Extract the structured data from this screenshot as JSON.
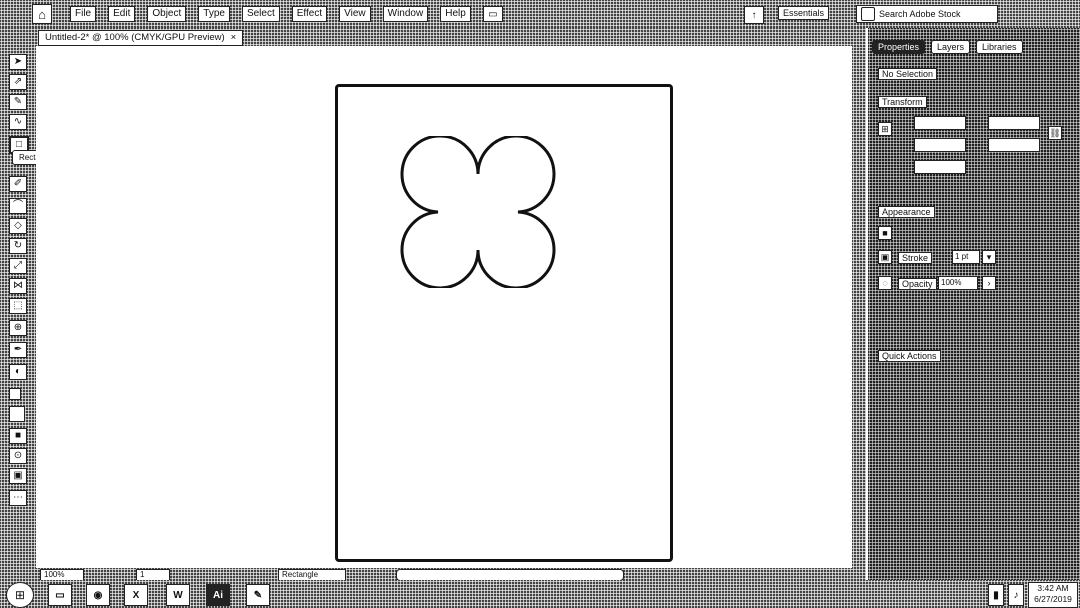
{
  "menubar": {
    "items": [
      "File",
      "Edit",
      "Object",
      "Type",
      "Select",
      "Effect",
      "View",
      "Window",
      "Help"
    ],
    "workspace_label": "Essentials",
    "search_placeholder": "Search Adobe Stock"
  },
  "document": {
    "tab_title": "Untitled-2* @ 100% (CMYK/GPU Preview)",
    "close_glyph": "×"
  },
  "tooltip": {
    "text": "Rectangle Tool (M)"
  },
  "statusbar": {
    "zoom": "100%",
    "artboard_num": "1",
    "tool_name": "Rectangle"
  },
  "panel": {
    "tabs": [
      "Properties",
      "Layers",
      "Libraries"
    ],
    "sections": {
      "selection": "No Selection",
      "transform": "Transform",
      "appearance": "Appearance",
      "stroke_label": "Stroke",
      "stroke_value": "1 pt",
      "opacity_label": "Opacity",
      "opacity_value": "100%",
      "quick_actions": "Quick Actions"
    }
  },
  "taskbar": {
    "apps": [
      "Explorer",
      "Chrome",
      "Excel",
      "Word",
      "Ai",
      "Paint"
    ],
    "clock_time": "3:42 AM",
    "clock_date": "6/27/2019"
  }
}
